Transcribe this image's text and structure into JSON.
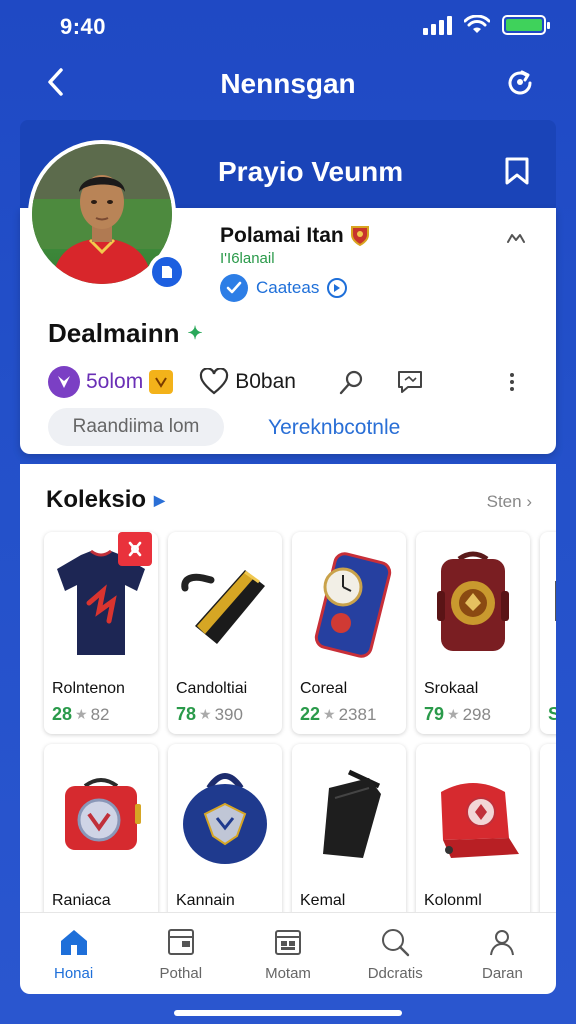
{
  "status_bar": {
    "time": "9:40",
    "battery_level": 1.0,
    "battery_color": "#3fd25b"
  },
  "header": {
    "title": "Nennsgan",
    "back_icon": "chevron-left-icon",
    "share_icon": "share-icon"
  },
  "profile": {
    "banner_name": "Prayio Veunm",
    "club_name": "Polamai Itan",
    "club_handle": "I'I6lanail",
    "verify_label": "Caateas",
    "username": "Dealmainn",
    "stat_likes": "5olom",
    "stat_followers": "B0ban",
    "search_placeholder": "Raandiima lom",
    "link_label": "Yereknbcotnle"
  },
  "collection": {
    "title": "Koleksio",
    "see_all": "Sten",
    "items": [
      {
        "name": "Rolntenon",
        "rating": "28",
        "count": "82"
      },
      {
        "name": "Candoltiai",
        "rating": "78",
        "count": "390"
      },
      {
        "name": "Coreal",
        "rating": "22",
        "count": "2381"
      },
      {
        "name": "Srokaal",
        "rating": "79",
        "count": "298"
      },
      {
        "name": "Raniaca"
      },
      {
        "name": "Kannain"
      },
      {
        "name": "Kemal"
      },
      {
        "name": "Kolonml"
      }
    ],
    "partial_rating": "S"
  },
  "nav": [
    {
      "label": "Honai",
      "icon": "home-icon",
      "active": true
    },
    {
      "label": "Pothal",
      "icon": "wallet-icon",
      "active": false
    },
    {
      "label": "Motam",
      "icon": "calendar-icon",
      "active": false
    },
    {
      "label": "Ddcratis",
      "icon": "search-icon",
      "active": false
    },
    {
      "label": "Daran",
      "icon": "profile-icon",
      "active": false
    }
  ],
  "colors": {
    "brand": "#1f49c4",
    "link": "#1e6fd9",
    "rating": "#2a9a4a",
    "badge": "#e9323c"
  }
}
